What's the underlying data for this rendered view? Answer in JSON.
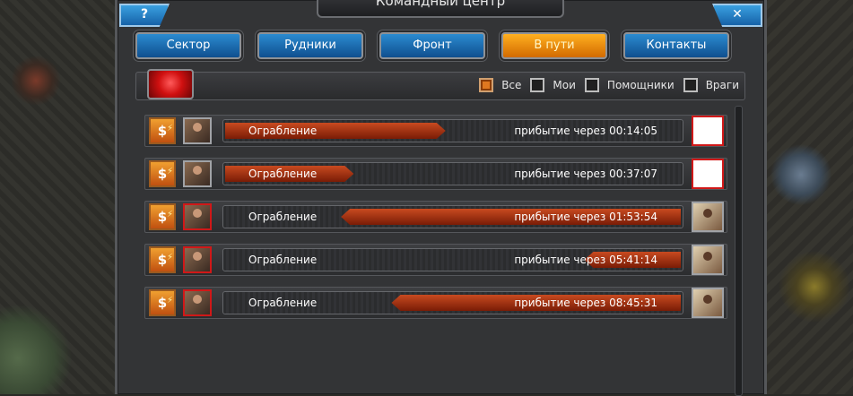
{
  "window": {
    "title": "Командный центр",
    "help_label": "?",
    "close_label": "✕"
  },
  "tabs": [
    {
      "label": "Сектор",
      "active": false
    },
    {
      "label": "Рудники",
      "active": false
    },
    {
      "label": "Фронт",
      "active": false
    },
    {
      "label": "В пути",
      "active": true
    },
    {
      "label": "Контакты",
      "active": false
    }
  ],
  "filters": [
    {
      "label": "Все",
      "checked": true
    },
    {
      "label": "Мои",
      "checked": false
    },
    {
      "label": "Помощники",
      "checked": false
    },
    {
      "label": "Враги",
      "checked": false
    }
  ],
  "missions": [
    {
      "icon": "money-lightning-icon",
      "name": "Ограбление",
      "arrival": "прибытие через 00:14:05",
      "progress": 0.48,
      "direction": "outgoing",
      "target": "empty"
    },
    {
      "icon": "money-lightning-icon",
      "name": "Ограбление",
      "arrival": "прибытие через 00:37:07",
      "progress": 0.28,
      "direction": "outgoing",
      "target": "empty"
    },
    {
      "icon": "money-lightning-icon",
      "name": "Ограбление",
      "arrival": "прибытие через 01:53:54",
      "progress": 0.74,
      "direction": "incoming",
      "target": "photo"
    },
    {
      "icon": "money-lightning-icon",
      "name": "Ограбление",
      "arrival": "прибытие через 05:41:14",
      "progress": 0.21,
      "direction": "incoming",
      "target": "photo"
    },
    {
      "icon": "money-lightning-icon",
      "name": "Ограбление",
      "arrival": "прибытие через 08:45:31",
      "progress": 0.63,
      "direction": "incoming",
      "target": "photo"
    }
  ],
  "icons": {
    "mission_glyph": "$",
    "mission_bolt": "⚡"
  },
  "colors": {
    "tab_blue": "#1f76bc",
    "tab_active": "#f08c10",
    "progress_bar": "#b03a14",
    "checked_box": "#e07820"
  }
}
